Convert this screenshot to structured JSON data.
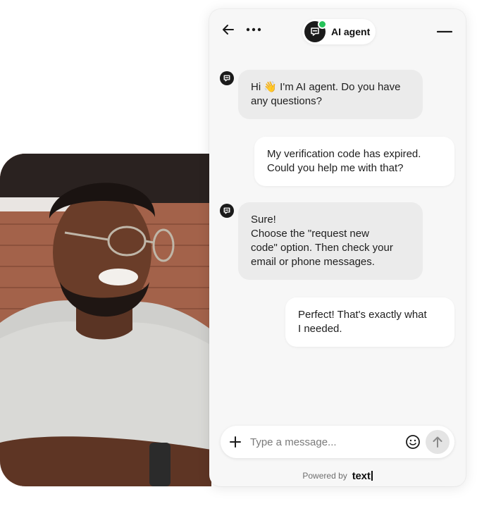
{
  "header": {
    "agent_name": "AI agent",
    "online_color": "#27c25a",
    "icons": {
      "back": "arrow-left-icon",
      "more": "more-horizontal-icon",
      "minimize": "minimize-icon"
    }
  },
  "messages": [
    {
      "role": "agent",
      "text": "Hi 👋 I'm AI agent. Do you have\nany questions?"
    },
    {
      "role": "user",
      "text": "My verification code has expired.\nCould you help me with that?"
    },
    {
      "role": "agent",
      "text": "Sure!\nChoose the \"request new\ncode\" option. Then check your\nemail or phone messages."
    },
    {
      "role": "user",
      "text": "Perfect! That's exactly what\nI needed."
    }
  ],
  "composer": {
    "placeholder": "Type a message...",
    "value": "",
    "icons": {
      "add": "plus-icon",
      "emoji": "smiley-icon",
      "send": "arrow-up-icon"
    }
  },
  "footer": {
    "powered_by": "Powered by",
    "brand": "text"
  }
}
